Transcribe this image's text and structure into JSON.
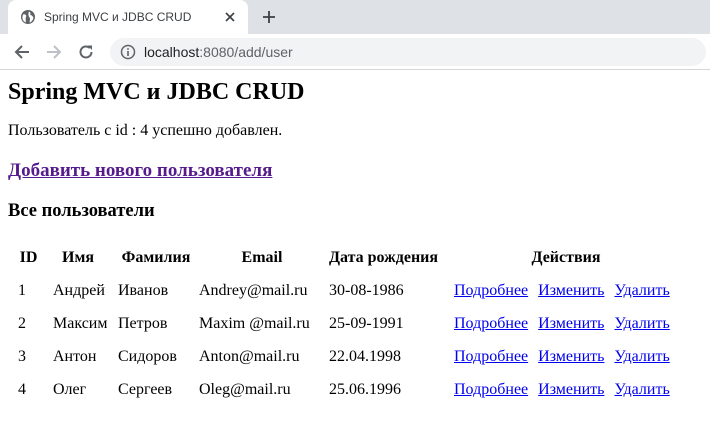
{
  "browser": {
    "tab_title": "Spring MVC и JDBC CRUD",
    "url_host": "localhost",
    "url_rest": ":8080/add/user"
  },
  "page": {
    "heading": "Spring MVC и JDBC CRUD",
    "message": "Пользователь с id : 4 успешно добавлен.",
    "add_link": "Добавить нового пользователя",
    "subheading": "Все пользователи"
  },
  "table": {
    "headers": {
      "id": "ID",
      "name": "Имя",
      "surname": "Фамилия",
      "email": "Email",
      "dob": "Дата рождения",
      "actions": "Действия"
    },
    "rows": [
      {
        "id": "1",
        "name": "Андрей",
        "surname": "Иванов",
        "email": "Andrey@mail.ru",
        "dob": "30-08-1986"
      },
      {
        "id": "2",
        "name": "Максим",
        "surname": "Петров",
        "email": "Maxim @mail.ru",
        "dob": "25-09-1991"
      },
      {
        "id": "3",
        "name": "Антон",
        "surname": "Сидоров",
        "email": "Anton@mail.ru",
        "dob": "22.04.1998"
      },
      {
        "id": "4",
        "name": "Олег",
        "surname": "Сергеев",
        "email": "Oleg@mail.ru",
        "dob": "25.06.1996"
      }
    ],
    "actions": {
      "details": "Подробнее",
      "edit": "Изменить",
      "delete": "Удалить"
    }
  },
  "colors": {
    "tabstrip": "#dee1e6",
    "visited_link": "#551a8b",
    "link": "#0000ee"
  },
  "icons": {
    "favicon": "globe-icon",
    "tab_close": "close-icon",
    "new_tab": "plus-icon",
    "back": "arrow-left-icon",
    "forward": "arrow-right-icon",
    "reload": "reload-icon",
    "site_info": "info-icon"
  }
}
